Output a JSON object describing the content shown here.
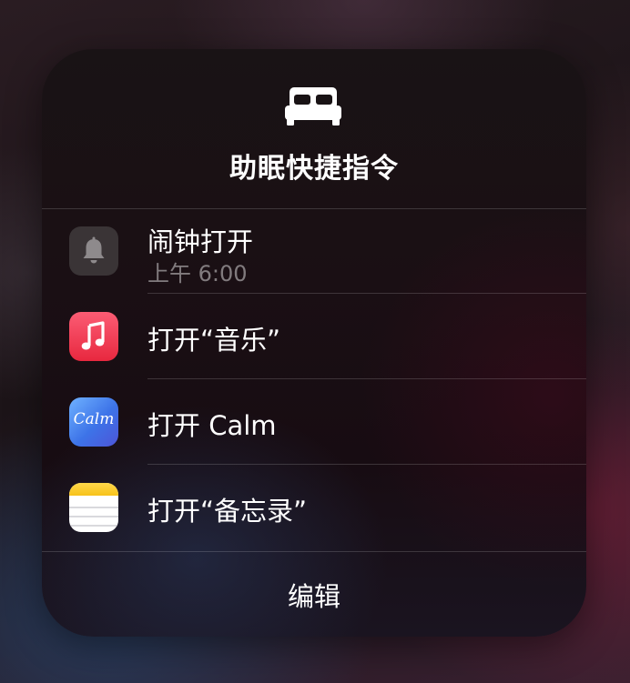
{
  "panel": {
    "title": "助眠快捷指令",
    "header_icon": "bed-icon"
  },
  "rows": [
    {
      "label": "闹钟打开",
      "sublabel": "上午 6:00",
      "icon": "alarm-bell-icon",
      "icon_color": "#3a3436"
    },
    {
      "label": "打开“音乐”",
      "icon": "music-app-icon",
      "icon_color": "#f23a52"
    },
    {
      "label": "打开 Calm",
      "icon": "calm-app-icon",
      "icon_text": "Calm",
      "icon_color": "#4f8cf0"
    },
    {
      "label": "打开“备忘录”",
      "icon": "notes-app-icon",
      "icon_color": "#f7c21a"
    }
  ],
  "footer": {
    "edit_label": "编辑"
  }
}
